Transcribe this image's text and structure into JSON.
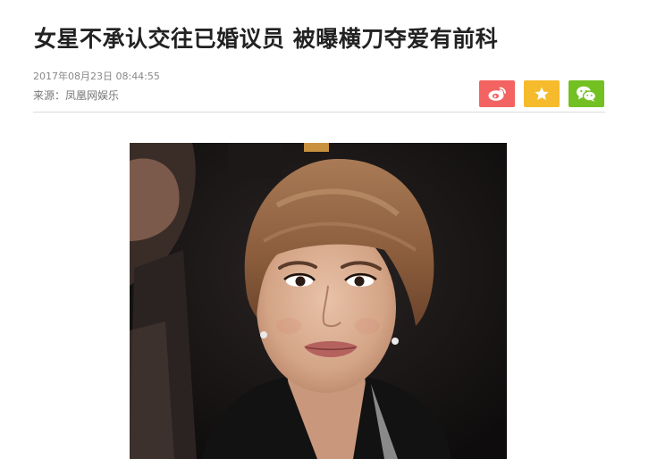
{
  "article": {
    "title": "女星不承认交往已婚议员 被曝横刀夺爱有前科",
    "date": "2017年08月23日 08:44:55",
    "source": "来源：凤凰网娱乐"
  },
  "share": {
    "weibo_icon": "weibo-icon",
    "favorite_icon": "star-icon",
    "wechat_icon": "wechat-icon",
    "colors": {
      "weibo": "#f26361",
      "favorite": "#f6bb2c",
      "wechat": "#73c022"
    }
  },
  "image": {
    "subject": "portrait-photo"
  }
}
